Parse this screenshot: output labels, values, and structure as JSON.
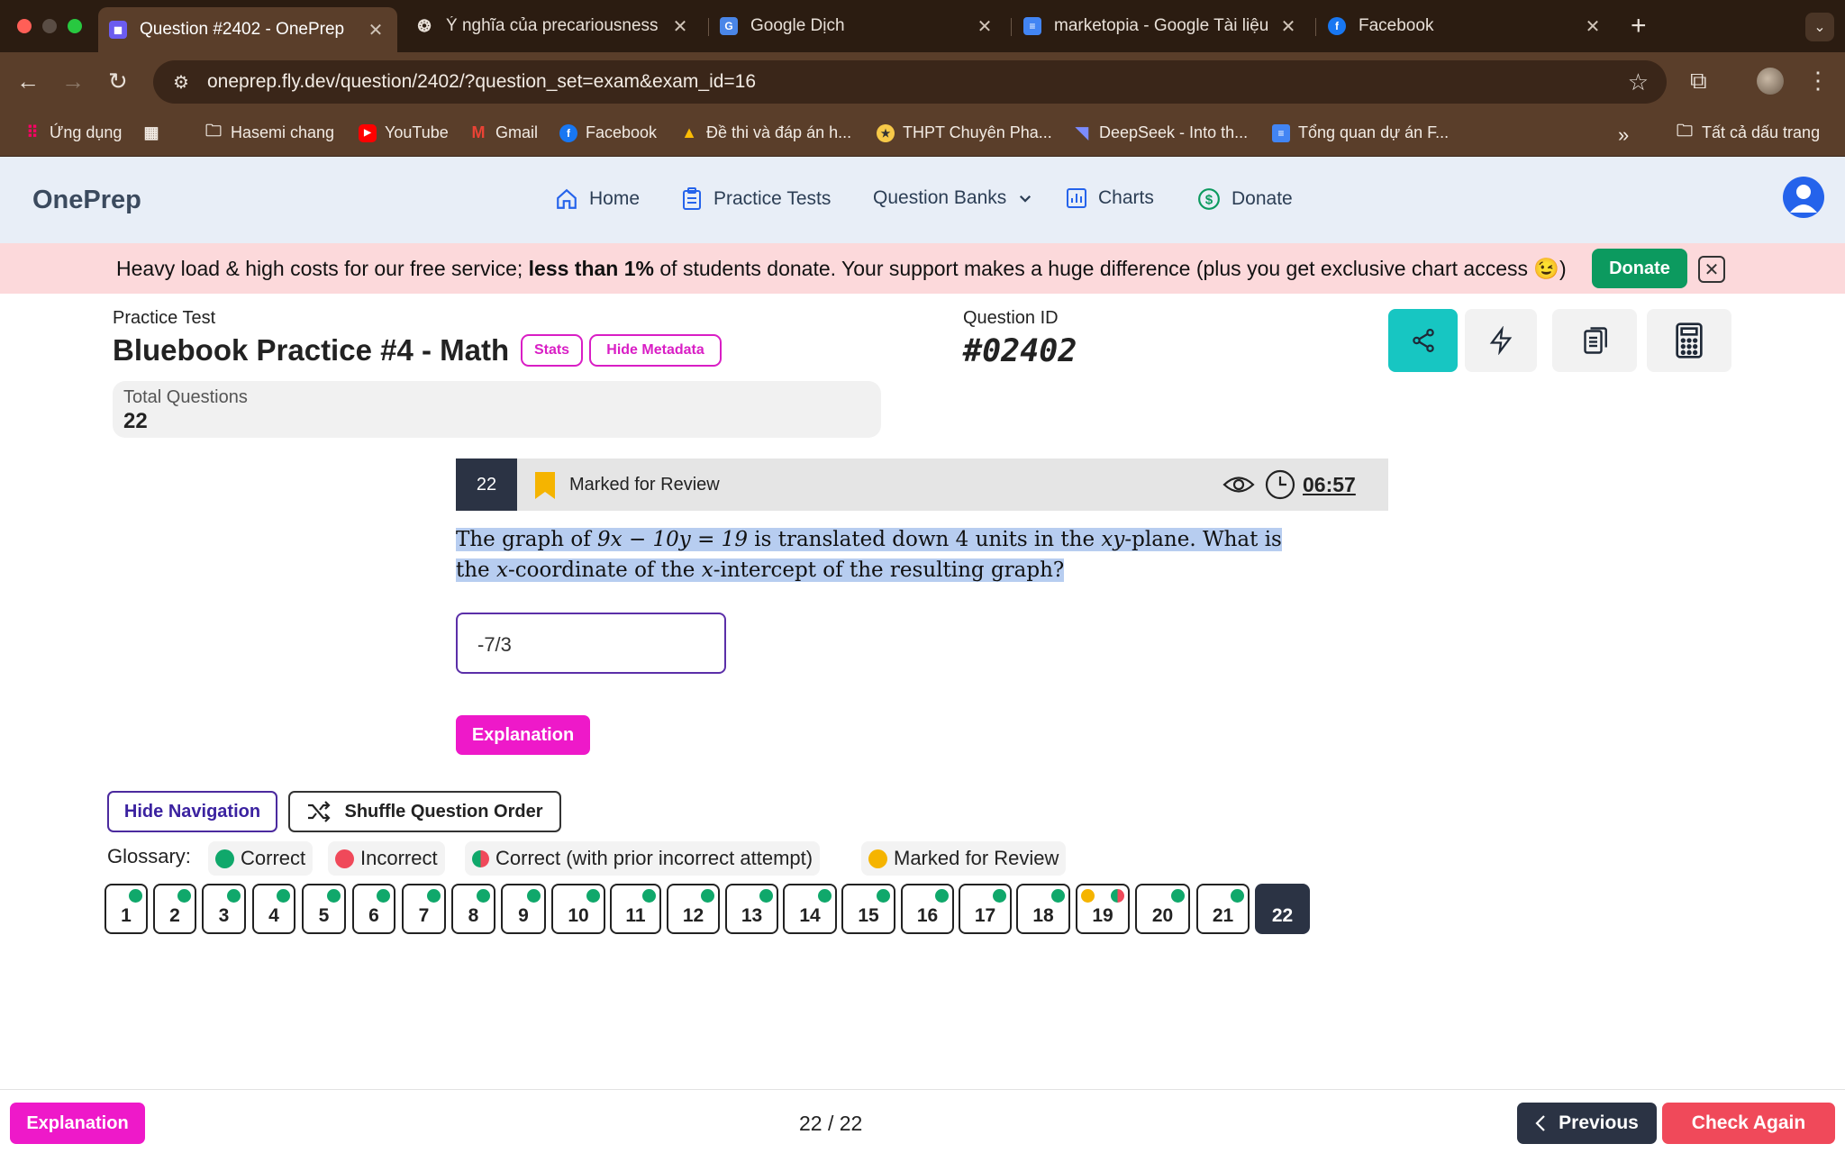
{
  "browser": {
    "tabs": [
      {
        "title": "Question #2402 - OnePrep",
        "active": true,
        "icon": "oneprep-favicon"
      },
      {
        "title": "Ý nghĩa của precariousness",
        "active": false,
        "icon": "openai-favicon"
      },
      {
        "title": "Google Dịch",
        "active": false,
        "icon": "google-translate-favicon"
      },
      {
        "title": "marketopia - Google Tài liệu",
        "active": false,
        "icon": "google-docs-favicon"
      },
      {
        "title": "Facebook",
        "active": false,
        "icon": "facebook-favicon"
      }
    ],
    "url": "oneprep.fly.dev/question/2402/?question_set=exam&exam_id=16",
    "bookmarks": [
      {
        "label": "Ứng dụng",
        "icon": "apps-grid-icon"
      },
      {
        "label": "Hasemi chang",
        "icon": "folder-icon"
      },
      {
        "label": "YouTube",
        "icon": "youtube-icon"
      },
      {
        "label": "Gmail",
        "icon": "gmail-icon"
      },
      {
        "label": "Facebook",
        "icon": "facebook-icon"
      },
      {
        "label": "Đề thi và đáp án h...",
        "icon": "drive-icon"
      },
      {
        "label": "THPT Chuyên Pha...",
        "icon": "school-icon"
      },
      {
        "label": "DeepSeek - Into th...",
        "icon": "deepseek-icon"
      },
      {
        "label": "Tổng quan dự án F...",
        "icon": "docs-icon"
      }
    ],
    "all_bookmarks": "Tất cả dấu trang"
  },
  "header": {
    "logo": "OnePrep",
    "nav": [
      {
        "label": "Home",
        "icon": "home-icon"
      },
      {
        "label": "Practice Tests",
        "icon": "clipboard-icon"
      },
      {
        "label": "Question Banks",
        "icon": "chevron-down-icon"
      },
      {
        "label": "Charts",
        "icon": "chart-icon"
      },
      {
        "label": "Donate",
        "icon": "dollar-icon"
      }
    ]
  },
  "banner": {
    "text_before": "Heavy load & high costs for our free service; ",
    "text_bold": "less than 1%",
    "text_after": " of students donate. Your support makes a huge difference (plus you get exclusive chart access 😉)",
    "donate_label": "Donate"
  },
  "meta": {
    "practice_test_label": "Practice Test",
    "test_title": "Bluebook Practice #4 - Math",
    "stats_label": "Stats",
    "hide_metadata_label": "Hide Metadata",
    "question_id_label": "Question ID",
    "question_id": "#02402",
    "total_questions_label": "Total Questions",
    "total_questions": "22"
  },
  "question": {
    "number": "22",
    "marked_label": "Marked for Review",
    "timer": "06:57",
    "text_1": "The graph of ",
    "eq": "9x − 10y = 19",
    "text_2": " is translated down ",
    "num": "4",
    "text_3": " units in the ",
    "xy": "xy",
    "text_4": "-plane. What is the ",
    "x1": "x",
    "text_5": "-coordinate of the ",
    "x2": "x",
    "text_6": "-intercept of the resulting graph?",
    "answer": "-7/3",
    "explanation_label": "Explanation"
  },
  "controls": {
    "hide_navigation": "Hide Navigation",
    "shuffle": "Shuffle Question Order"
  },
  "glossary": {
    "label": "Glossary:",
    "items": [
      {
        "label": "Correct",
        "color": "#10a86b"
      },
      {
        "label": "Incorrect",
        "color": "#f0495a"
      },
      {
        "label": "Correct (with prior incorrect attempt)",
        "color": "split"
      },
      {
        "label": "Marked for Review",
        "color": "#f5b400"
      }
    ]
  },
  "question_nav": [
    {
      "n": "1",
      "status": "correct"
    },
    {
      "n": "2",
      "status": "correct"
    },
    {
      "n": "3",
      "status": "correct"
    },
    {
      "n": "4",
      "status": "correct"
    },
    {
      "n": "5",
      "status": "correct"
    },
    {
      "n": "6",
      "status": "correct"
    },
    {
      "n": "7",
      "status": "correct"
    },
    {
      "n": "8",
      "status": "correct"
    },
    {
      "n": "9",
      "status": "correct"
    },
    {
      "n": "10",
      "status": "correct"
    },
    {
      "n": "11",
      "status": "correct"
    },
    {
      "n": "12",
      "status": "correct"
    },
    {
      "n": "13",
      "status": "correct"
    },
    {
      "n": "14",
      "status": "correct"
    },
    {
      "n": "15",
      "status": "correct"
    },
    {
      "n": "16",
      "status": "correct"
    },
    {
      "n": "17",
      "status": "correct"
    },
    {
      "n": "18",
      "status": "correct"
    },
    {
      "n": "19",
      "status": "marked+prior"
    },
    {
      "n": "20",
      "status": "correct"
    },
    {
      "n": "21",
      "status": "correct"
    },
    {
      "n": "22",
      "status": "current"
    }
  ],
  "footer": {
    "explanation_label": "Explanation",
    "counter": "22 / 22",
    "previous_label": "Previous",
    "check_again_label": "Check Again"
  }
}
